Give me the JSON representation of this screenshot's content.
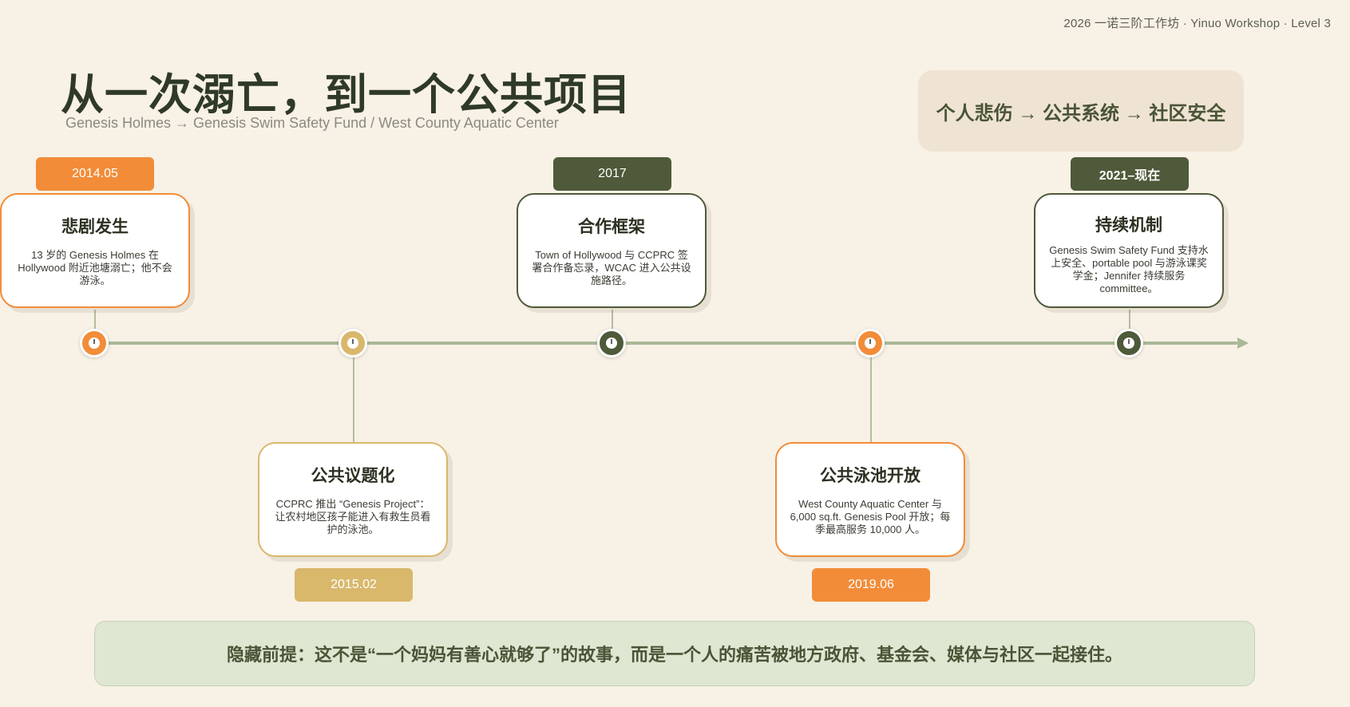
{
  "header": {
    "meta": "2026 一诺三阶工作坊 · Yinuo Workshop · Level 3",
    "title": "从一次溺亡，到一个公共项目",
    "subtitle": "Genesis Holmes → Genesis Swim Safety Fund / West County Aquatic Center"
  },
  "tagline": "个人悲伤 → 公共系统 → 社区安全",
  "colors": {
    "orange": "#f28c38",
    "tan": "#d9b86c",
    "dark_green": "#4e5a39",
    "axis": "#a9b897",
    "background": "#f8f1e6"
  },
  "timeline": [
    {
      "date": "2014.05",
      "title": "悲剧发生",
      "desc": "13 岁的 Genesis Holmes 在 Hollywood 附近池塘溺亡；他不会游泳。",
      "color": "orange",
      "position": "above"
    },
    {
      "date": "2015.02",
      "title": "公共议题化",
      "desc": "CCPRC 推出 “Genesis Project”：让农村地区孩子能进入有救生员看护的泳池。",
      "color": "tan",
      "position": "below"
    },
    {
      "date": "2017",
      "title": "合作框架",
      "desc": "Town of Hollywood 与 CCPRC 签署合作备忘录，WCAC 进入公共设施路径。",
      "color": "dark_green",
      "position": "above"
    },
    {
      "date": "2019.06",
      "title": "公共泳池开放",
      "desc": "West County Aquatic Center 与 6,000 sq.ft. Genesis Pool 开放；每季最高服务 10,000 人。",
      "color": "orange",
      "position": "below"
    },
    {
      "date": "2021–现在",
      "title": "持续机制",
      "desc": "Genesis Swim Safety Fund 支持水上安全、portable pool 与游泳课奖学金；Jennifer 持续服务 committee。",
      "color": "dark_green",
      "position": "above"
    }
  ],
  "premise": "隐藏前提：这不是“一个妈妈有善心就够了”的故事，而是一个人的痛苦被地方政府、基金会、媒体与社区一起接住。"
}
